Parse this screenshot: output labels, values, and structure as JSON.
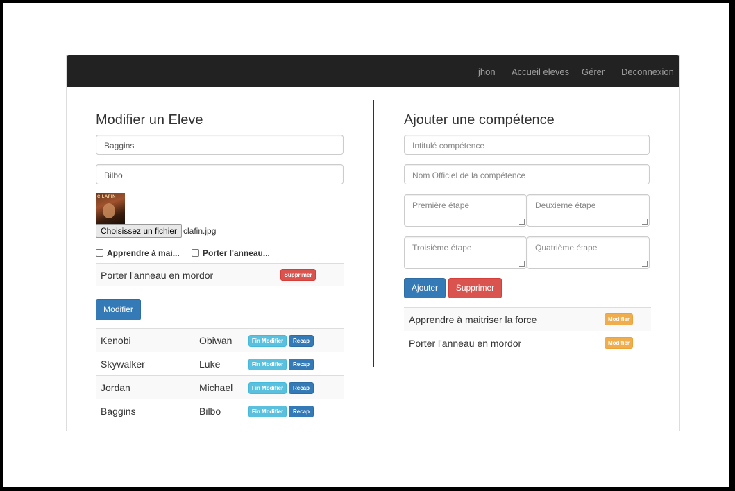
{
  "nav": {
    "user": "jhon",
    "home": "Accueil eleves",
    "manage": "Gérer",
    "logout": "Deconnexion"
  },
  "left": {
    "title": "Modifier un Eleve",
    "lastname_value": "Baggins",
    "firstname_value": "Bilbo",
    "photo_text": "C'LAFIN",
    "file_button": "Choisissez un fichier",
    "file_name": "clafin.jpg",
    "checkboxes": [
      "Apprendre à mai...",
      "Porter l'anneau..."
    ],
    "skill_row": {
      "name": "Porter l'anneau en mordor",
      "delete_label": "Supprimer"
    },
    "submit_label": "Modifier",
    "students": [
      {
        "last": "Kenobi",
        "first": "Obiwan",
        "fin_label": "Fin Modifier",
        "recap_label": "Recap"
      },
      {
        "last": "Skywalker",
        "first": "Luke",
        "fin_label": "Fin Modifier",
        "recap_label": "Recap"
      },
      {
        "last": "Jordan",
        "first": "Michael",
        "fin_label": "Fin Modifier",
        "recap_label": "Recap"
      },
      {
        "last": "Baggins",
        "first": "Bilbo",
        "fin_label": "Fin Modifier",
        "recap_label": "Recap"
      }
    ]
  },
  "right": {
    "title": "Ajouter une compétence",
    "title_placeholder": "Intitulé compétence",
    "official_placeholder": "Nom Officiel de la compétence",
    "step1_placeholder": "Première étape",
    "step2_placeholder": "Deuxieme étape",
    "step3_placeholder": "Troisième étape",
    "step4_placeholder": "Quatrième étape",
    "add_label": "Ajouter",
    "delete_label": "Supprimer",
    "skills": [
      {
        "name": "Apprendre à maitriser la force",
        "edit_label": "Modifier"
      },
      {
        "name": "Porter l'anneau en mordor",
        "edit_label": "Modifier"
      }
    ]
  },
  "colors": {
    "navbar": "#222222",
    "primary": "#337ab7",
    "danger": "#d9534f",
    "info": "#5bc0de",
    "warning": "#f0ad4e"
  }
}
